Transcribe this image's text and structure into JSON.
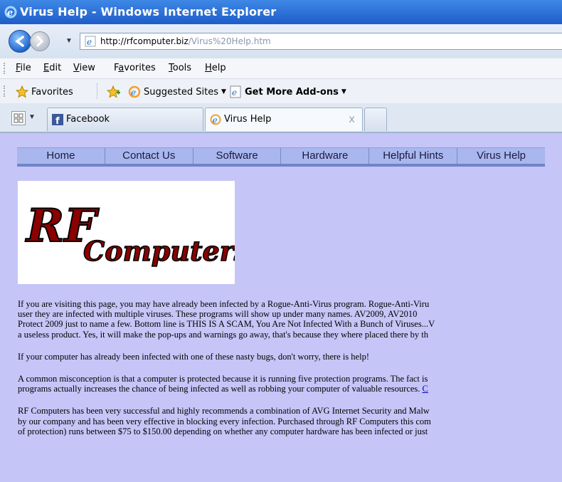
{
  "window": {
    "title": "Virus Help - Windows Internet Explorer"
  },
  "address": {
    "url_host": "http://rfcomputer.biz",
    "url_path": "/Virus%20Help.htm"
  },
  "menu": {
    "items": [
      "File",
      "Edit",
      "View",
      "Favorites",
      "Tools",
      "Help"
    ]
  },
  "favorites_bar": {
    "favorites": "Favorites",
    "suggested": "Suggested Sites",
    "addons": "Get More Add-ons"
  },
  "tabs": [
    {
      "label": "Facebook",
      "active": false
    },
    {
      "label": "Virus Help",
      "active": true,
      "close": "x"
    }
  ],
  "site_nav": [
    "Home",
    "Contact Us",
    "Software",
    "Hardware",
    "Helpful Hints",
    "Virus Help"
  ],
  "logo": {
    "line1": "RF",
    "line2": "Computers"
  },
  "paragraphs": {
    "p1": [
      "If you are visiting this page, you may have already been infected by a Rogue-Anti-Virus program. Rogue-Anti-Viru",
      "user they are infected with multiple viruses. These programs will show up under many names. AV2009, AV2010",
      "Protect 2009 just to name a few. Bottom line is THIS IS A SCAM, You Are Not Infected With a Bunch of Viruses...V",
      "a useless product. Yes, it will make the pop-ups and warnings go away, that's because they where placed there by th"
    ],
    "p2": "If your computer has already been infected with one of these nasty bugs, don't worry, there is help!",
    "p3_line1": "A common misconception is that a computer is protected because it is running five protection programs. The fact is",
    "p3_line2": "programs actually increases the chance of being infected as well as robbing your computer of valuable resources.",
    "p3_link": "C",
    "p4": [
      "RF Computers has been very successful and highly recommends a combination of AVG Internet Security and Malw",
      "by our company and has been very effective in blocking every infection. Purchased through RF Computers this com",
      "of protection) runs between $75 to $150.00 depending on whether any computer hardware has been infected or just"
    ]
  },
  "colors": {
    "page_bg": "#c5c5f7",
    "nav_bg": "#a9b7ee",
    "logo_text": "#8b0000",
    "titlebar": "#2a6fd6"
  }
}
